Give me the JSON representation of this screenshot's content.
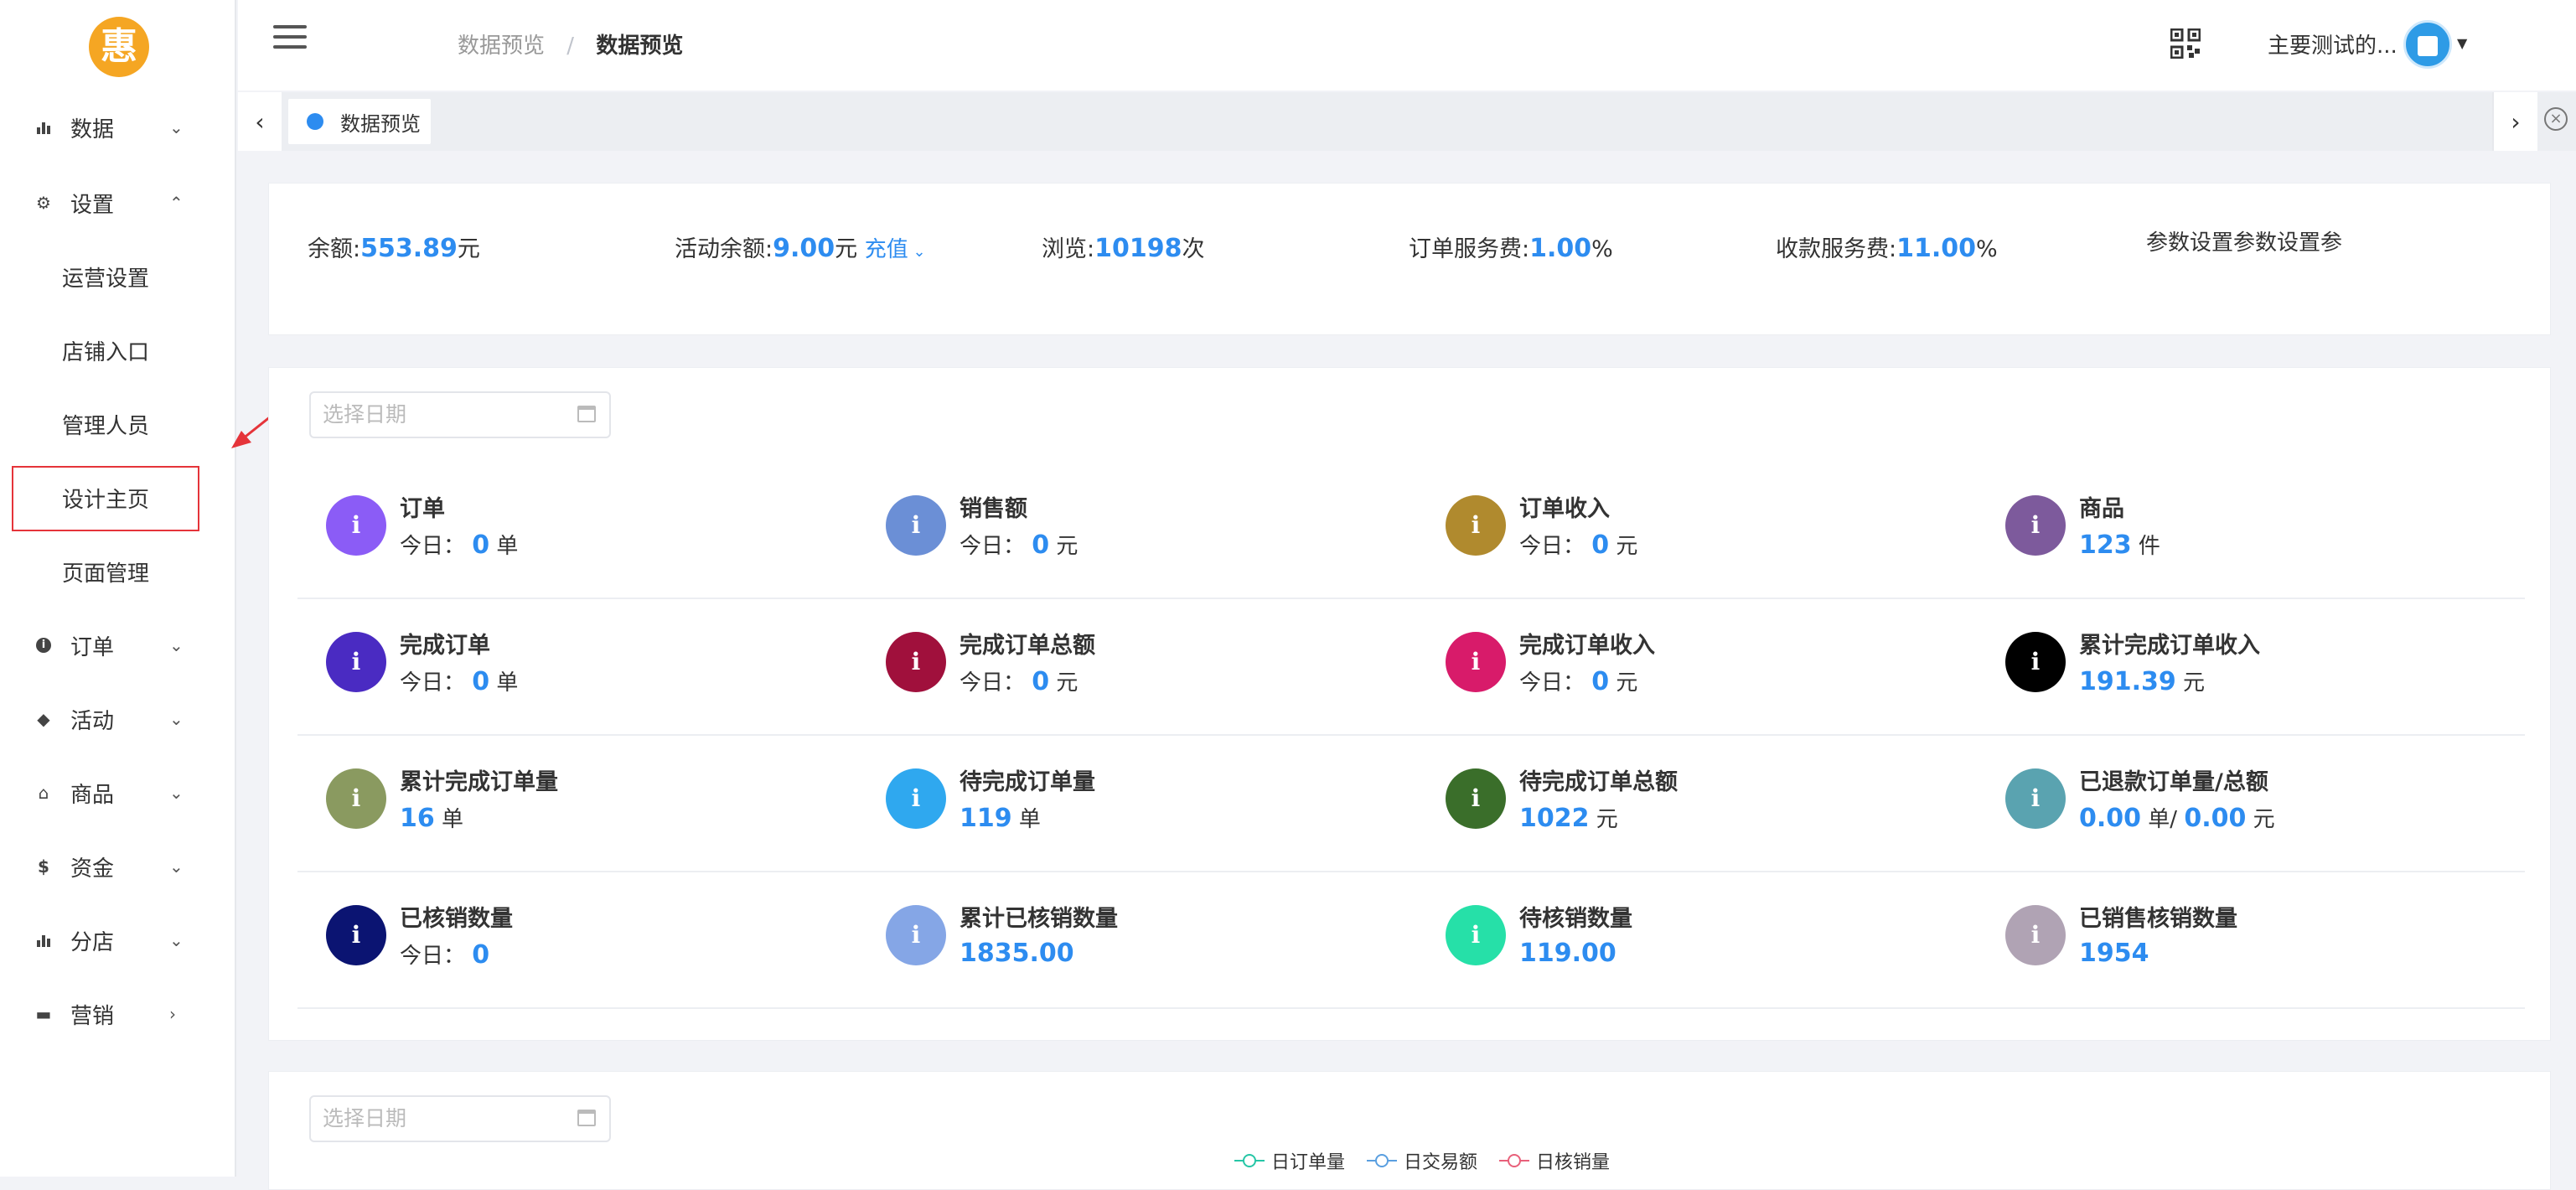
{
  "logo": {
    "char": "惠"
  },
  "sidebar": {
    "items": [
      {
        "label": "数据",
        "icon": "bar-chart-icon",
        "chevron": "down"
      },
      {
        "label": "设置",
        "icon": "gear-icon",
        "chevron": "up"
      },
      {
        "label": "订单",
        "icon": "info-icon",
        "chevron": "down"
      },
      {
        "label": "活动",
        "icon": "tag-icon",
        "chevron": "down"
      },
      {
        "label": "商品",
        "icon": "basket-icon",
        "chevron": "down"
      },
      {
        "label": "资金",
        "icon": "dollar-icon",
        "chevron": "down"
      },
      {
        "label": "分店",
        "icon": "bar-chart-icon",
        "chevron": "down"
      },
      {
        "label": "营销",
        "icon": "folder-icon",
        "chevron": "right"
      }
    ],
    "settings_sub": [
      "运营设置",
      "店铺入口",
      "管理人员",
      "设计主页",
      "页面管理"
    ]
  },
  "header": {
    "breadcrumb": [
      "数据预览",
      "数据预览"
    ],
    "breadcrumb_sep": "/",
    "user_name": "主要测试的...",
    "icons": [
      "menu-icon",
      "qr-code-icon",
      "avatar",
      "caret-down-icon"
    ]
  },
  "tabbar": {
    "active_tab": "数据预览"
  },
  "stats": {
    "balance": {
      "label": "余额:",
      "value": "553.89",
      "unit": "元"
    },
    "activity_balance": {
      "label": "活动余额:",
      "value": "9.00",
      "unit": "元",
      "link": "充值"
    },
    "views": {
      "label": "浏览:",
      "value": "10198",
      "unit": "次"
    },
    "order_fee": {
      "label": "订单服务费:",
      "value": "1.00",
      "unit": "%"
    },
    "collect_fee": {
      "label": "收款服务费:",
      "value": "11.00",
      "unit": "%"
    },
    "note": "参数设置参数设置参"
  },
  "date_picker": {
    "placeholder": "选择日期"
  },
  "metrics": [
    {
      "title": "订单",
      "prefix": "今日：",
      "value": "0",
      "unit": "单",
      "color": "#8b5cf6"
    },
    {
      "title": "销售额",
      "prefix": "今日：",
      "value": "0",
      "unit": "元",
      "color": "#6b8fd6"
    },
    {
      "title": "订单收入",
      "prefix": "今日：",
      "value": "0",
      "unit": "元",
      "color": "#b08a2e"
    },
    {
      "title": "商品",
      "prefix": "",
      "value": "123",
      "unit": "件",
      "color": "#7d5a9c"
    },
    {
      "title": "完成订单",
      "prefix": "今日：",
      "value": "0",
      "unit": "单",
      "color": "#4a2bc2"
    },
    {
      "title": "完成订单总额",
      "prefix": "今日：",
      "value": "0",
      "unit": "元",
      "color": "#a0103c"
    },
    {
      "title": "完成订单收入",
      "prefix": "今日：",
      "value": "0",
      "unit": "元",
      "color": "#d81b6a"
    },
    {
      "title": "累计完成订单收入",
      "prefix": "",
      "value": "191.39",
      "unit": "元",
      "color": "#000000"
    },
    {
      "title": "累计完成订单量",
      "prefix": "",
      "value": "16",
      "unit": "单",
      "color": "#8a9a60"
    },
    {
      "title": "待完成订单量",
      "prefix": "",
      "value": "119",
      "unit": "单",
      "color": "#2fa8ef"
    },
    {
      "title": "待完成订单总额",
      "prefix": "",
      "value": "1022",
      "unit": "元",
      "color": "#3a6e2a"
    },
    {
      "title": "已退款订单量/总额",
      "prefix": "",
      "value": "0.00",
      "unit": "单/",
      "value2": "0.00",
      "unit2": "元",
      "color": "#5aa3b0"
    },
    {
      "title": "已核销数量",
      "prefix": "今日：",
      "value": "0",
      "unit": "",
      "color": "#0b1472"
    },
    {
      "title": "累计已核销数量",
      "prefix": "",
      "value": "1835.00",
      "unit": "",
      "color": "#85a6e6"
    },
    {
      "title": "待核销数量",
      "prefix": "",
      "value": "119.00",
      "unit": "",
      "color": "#26e0a8"
    },
    {
      "title": "已销售核销数量",
      "prefix": "",
      "value": "1954",
      "unit": "",
      "color": "#b0a3b4"
    }
  ],
  "chart": {
    "date_placeholder": "选择日期",
    "legend": [
      {
        "name": "日订单量",
        "color": "#26c6a6"
      },
      {
        "name": "日交易额",
        "color": "#5a9fe0"
      },
      {
        "name": "日核销量",
        "color": "#e8607a"
      }
    ]
  }
}
